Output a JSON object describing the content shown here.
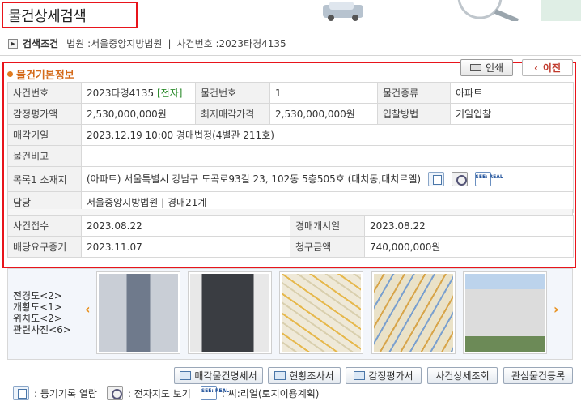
{
  "page": {
    "title": "물건상세검색"
  },
  "criteria": {
    "label": "검색조건",
    "court_label": "법원 : ",
    "court": "서울중앙지방법원",
    "separator": "|",
    "case_label": "사건번호 : ",
    "case": "2023타경4135"
  },
  "section": {
    "title": "물건기본정보"
  },
  "buttons": {
    "print": "인쇄",
    "prev": "이전"
  },
  "basic": {
    "row1": {
      "h1": "사건번호",
      "v1": "2023타경4135",
      "v1_badge": "[전자]",
      "h2": "물건번호",
      "v2": "1",
      "h3": "물건종류",
      "v3": "아파트"
    },
    "row2": {
      "h1": "감정평가액",
      "v1": "2,530,000,000원",
      "h2": "최저매각가격",
      "v2": "2,530,000,000원",
      "h3": "입찰방법",
      "v3": "기일입찰"
    },
    "row3": {
      "h": "매각기일",
      "v": "2023.12.19 10:00 경매법정(4별관 211호)"
    },
    "row4": {
      "h": "물건비고",
      "v": ""
    },
    "row5": {
      "h": "목록1 소재지",
      "v": "(아파트) 서울특별시 강남구 도곡로93길 23, 102동 5층505호 (대치동,대치르엘)"
    },
    "row6": {
      "h": "담당",
      "v": "서울중앙지방법원 | 경매21계"
    }
  },
  "case_info": {
    "row1": {
      "h1": "사건접수",
      "v1": "2023.08.22",
      "h2": "경매개시일",
      "v2": "2023.08.22"
    },
    "row2": {
      "h1": "배당요구종기",
      "v1": "2023.11.07",
      "h2": "청구금액",
      "v2": "740,000,000원"
    }
  },
  "photos": {
    "labels": [
      "전경도<2>",
      "개황도<1>",
      "위치도<2>",
      "관련사진<6>"
    ],
    "prev_arrow": "‹",
    "next_arrow": "›"
  },
  "actions": {
    "sale_spec": "매각물건명세서",
    "status_report": "현황조사서",
    "appraisal": "감정평가서",
    "case_detail": "사건상세조회",
    "watchlist": "관심물건등록"
  },
  "legend": {
    "registry": ": 등기기록 열람",
    "map": ": 전자지도 보기",
    "seereal": ": 씨:리얼(토지이용계획)",
    "see_text": "SEE: REAL"
  },
  "icons": {
    "criteria": "arrow-right-icon",
    "registry": "document-icon",
    "map": "map-magnifier-icon",
    "seereal": "seereal-icon"
  },
  "colors": {
    "highlight": "#e8141b",
    "section_title": "#d46a1a",
    "badge": "#2a8a2a",
    "arrow": "#e8901d"
  }
}
